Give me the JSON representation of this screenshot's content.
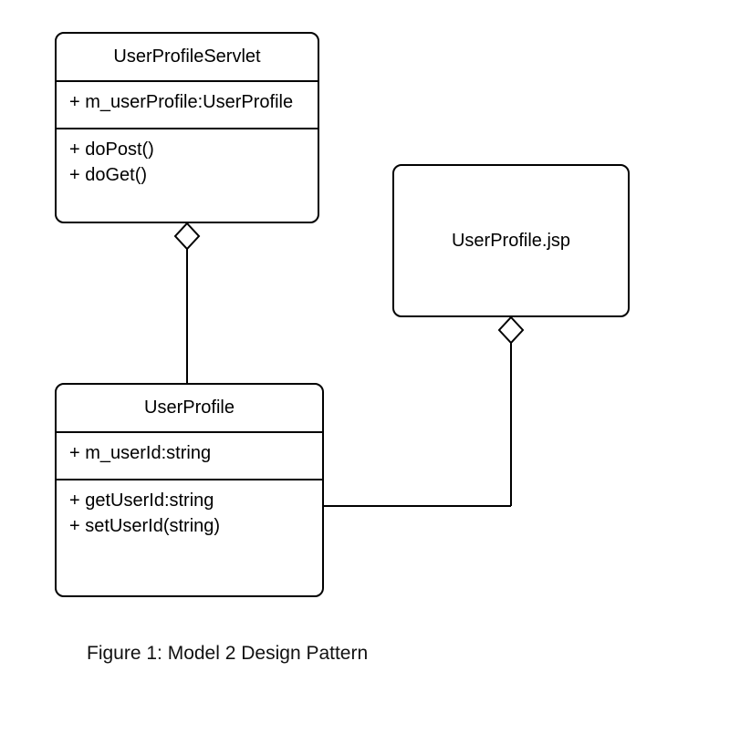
{
  "diagram": {
    "caption": "Figure 1: Model 2 Design Pattern",
    "classes": {
      "servlet": {
        "name": "UserProfileServlet",
        "attributes": [
          "+ m_userProfile:UserProfile"
        ],
        "methods": [
          "+ doPost()",
          "+ doGet()"
        ]
      },
      "jsp": {
        "name": "UserProfile.jsp"
      },
      "profile": {
        "name": "UserProfile",
        "attributes": [
          "+ m_userId:string"
        ],
        "methods": [
          "+ getUserId:string",
          "+ setUserId(string)"
        ]
      }
    },
    "relations": [
      {
        "from": "servlet",
        "to": "profile",
        "type": "aggregation"
      },
      {
        "from": "jsp",
        "to": "profile",
        "type": "aggregation"
      }
    ]
  }
}
